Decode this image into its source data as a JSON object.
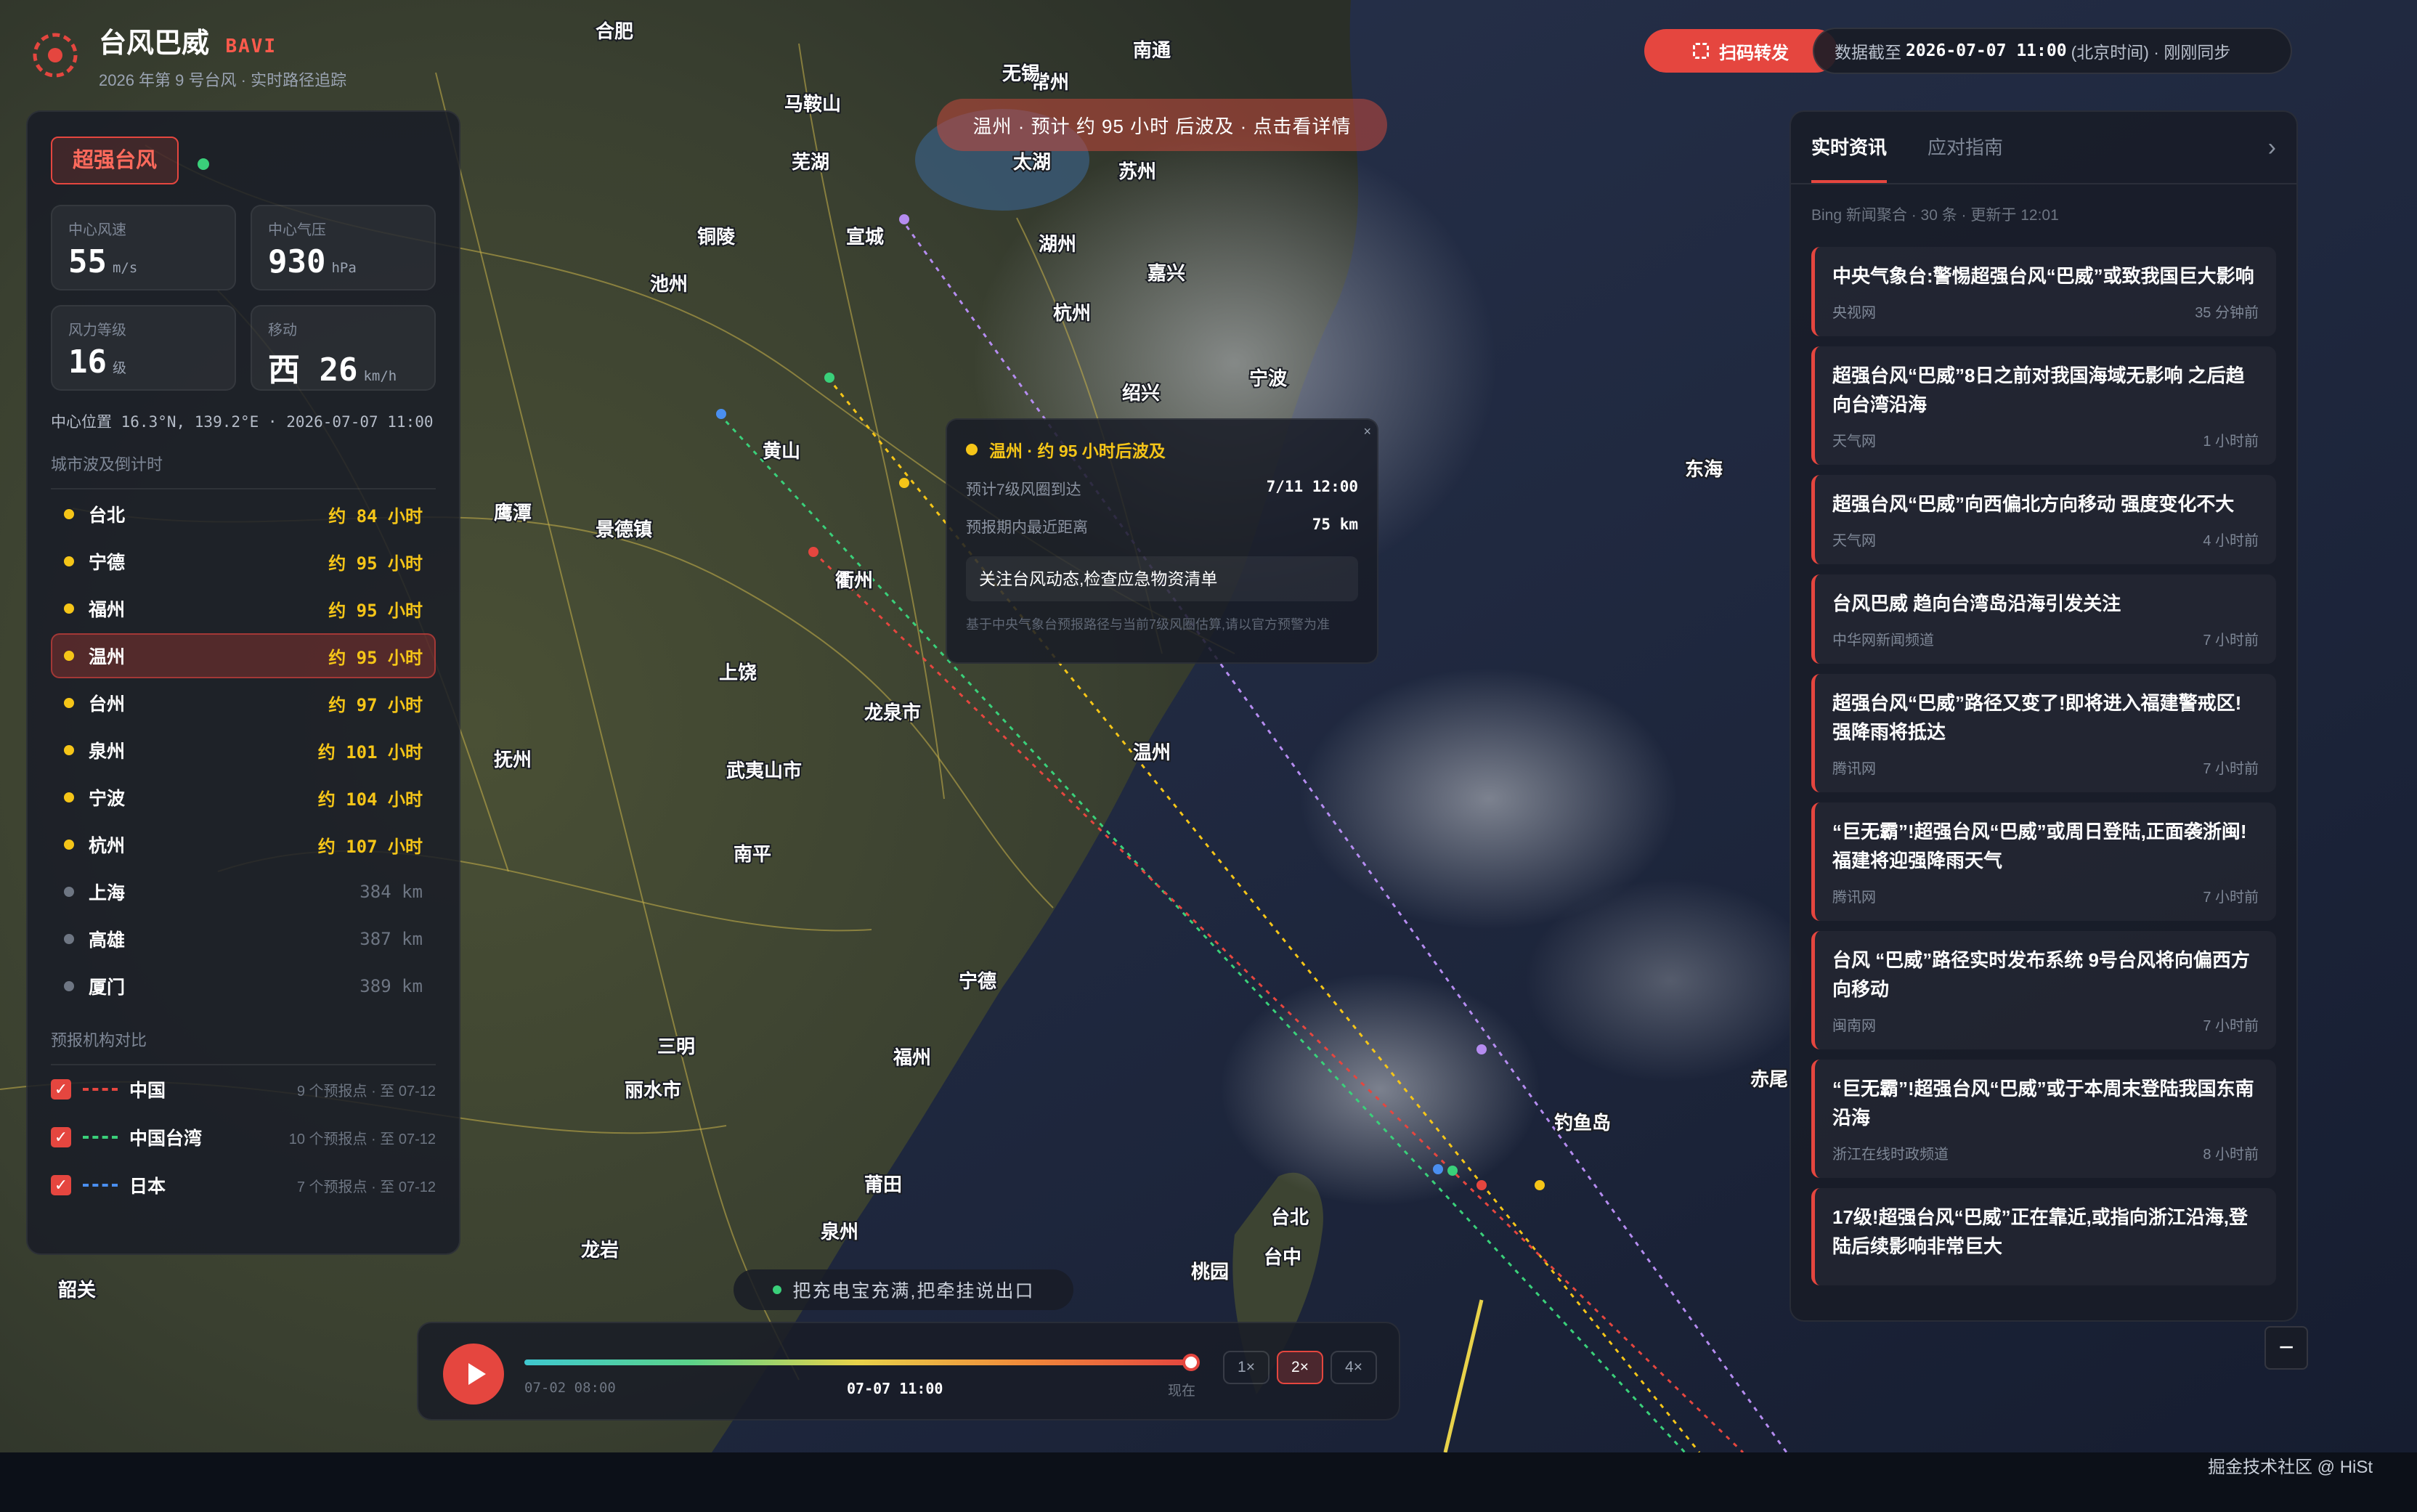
{
  "app": {
    "title": "台风巴威",
    "code": "BAVI",
    "subtitle": "2026 年第 9 号台风 · 实时路径追踪"
  },
  "header": {
    "share_label": "扫码转发",
    "data_time_prefix": "数据截至",
    "data_time_value": "2026-07-07 11:00",
    "data_time_suffix": "(北京时间) · 刚刚同步"
  },
  "alert_banner": "温州 · 预计 约 95 小时 后波及 · 点击看详情",
  "storm": {
    "level": "超强台风",
    "stats": [
      {
        "label": "中心风速",
        "value": "55",
        "unit": "m/s"
      },
      {
        "label": "中心气压",
        "value": "930",
        "unit": "hPa"
      },
      {
        "label": "风力等级",
        "value": "16",
        "unit": "级"
      },
      {
        "label": "移动",
        "value": "西 26",
        "unit": "km/h"
      }
    ],
    "center_position": "中心位置 16.3°N, 139.2°E · 2026-07-07 11:00"
  },
  "cities": {
    "title": "城市波及倒计时",
    "items": [
      {
        "name": "台北",
        "eta": "约 84 小时",
        "reached": true
      },
      {
        "name": "宁德",
        "eta": "约 95 小时",
        "reached": true
      },
      {
        "name": "福州",
        "eta": "约 95 小时",
        "reached": true
      },
      {
        "name": "温州",
        "eta": "约 95 小时",
        "reached": true
      },
      {
        "name": "台州",
        "eta": "约 97 小时",
        "reached": true
      },
      {
        "name": "泉州",
        "eta": "约 101 小时",
        "reached": true
      },
      {
        "name": "宁波",
        "eta": "约 104 小时",
        "reached": true
      },
      {
        "name": "杭州",
        "eta": "约 107 小时",
        "reached": true
      },
      {
        "name": "上海",
        "eta": "384 km",
        "reached": false
      },
      {
        "name": "高雄",
        "eta": "387 km",
        "reached": false
      },
      {
        "name": "厦门",
        "eta": "389 km",
        "reached": false
      }
    ]
  },
  "agencies": {
    "title": "预报机构对比",
    "items": [
      {
        "name": "中国",
        "meta": "9 个预报点 · 至 07-12",
        "color": "#e5463f"
      },
      {
        "name": "中国台湾",
        "meta": "10 个预报点 · 至 07-12",
        "color": "#3ad07a"
      },
      {
        "name": "日本",
        "meta": "7 个预报点 · 至 07-12",
        "color": "#4a8ff0"
      }
    ]
  },
  "popup": {
    "title": "温州 · 约 95 小时后波及",
    "rows": [
      {
        "label": "预计7级风圈到达",
        "value": "7/11 12:00"
      },
      {
        "label": "预报期内最近距离",
        "value": "75 km"
      }
    ],
    "advice": "关注台风动态,检查应急物资清单",
    "note": "基于中央气象台预报路径与当前7级风圈估算,请以官方预警为准",
    "close": "×"
  },
  "news": {
    "tabs": [
      "实时资讯",
      "应对指南"
    ],
    "meta": "Bing 新闻聚合 · 30 条 · 更新于 12:01",
    "items": [
      {
        "title": "中央气象台:警惕超强台风“巴威”或致我国巨大影响",
        "source": "央视网",
        "time": "35 分钟前"
      },
      {
        "title": "超强台风“巴威”8日之前对我国海域无影响 之后趋向台湾沿海",
        "source": "天气网",
        "time": "1 小时前"
      },
      {
        "title": "超强台风“巴威”向西偏北方向移动 强度变化不大",
        "source": "天气网",
        "time": "4 小时前"
      },
      {
        "title": "台风巴威 趋向台湾岛沿海引发关注",
        "source": "中华网新闻频道",
        "time": "7 小时前"
      },
      {
        "title": "超强台风“巴威”路径又变了!即将进入福建警戒区!强降雨将抵达",
        "source": "腾讯网",
        "time": "7 小时前"
      },
      {
        "title": "“巨无霸”!超强台风“巴威”或周日登陆,正面袭浙闽!福建将迎强降雨天气",
        "source": "腾讯网",
        "time": "7 小时前"
      },
      {
        "title": "台风 “巴威”路径实时发布系统 9号台风将向偏西方向移动",
        "source": "闽南网",
        "time": "7 小时前"
      },
      {
        "title": "“巨无霸”!超强台风“巴威”或于本周末登陆我国东南沿海",
        "source": "浙江在线时政频道",
        "time": "8 小时前"
      },
      {
        "title": "17级!超强台风“巴威”正在靠近,或指向浙江沿海,登陆后续影响非常巨大",
        "source": "",
        "time": ""
      }
    ]
  },
  "tip": "把充电宝充满,把牵挂说出口",
  "timeline": {
    "start": "07-02 08:00",
    "current": "07-07 11:00",
    "end_label": "现在",
    "progress": 1.0,
    "speeds": [
      "1×",
      "2×",
      "4×"
    ],
    "active_speed": "2×"
  },
  "map": {
    "places": [
      {
        "name": "合肥"
      },
      {
        "name": "南通"
      },
      {
        "name": "常州"
      },
      {
        "name": "马鞍山"
      },
      {
        "name": "芜湖"
      },
      {
        "name": "无锡"
      },
      {
        "name": "苏州"
      },
      {
        "name": "太湖"
      },
      {
        "name": "铜陵"
      },
      {
        "name": "宣城"
      },
      {
        "name": "湖州"
      },
      {
        "name": "嘉兴"
      },
      {
        "name": "杭州"
      },
      {
        "name": "绍兴"
      },
      {
        "name": "宁波"
      },
      {
        "name": "池州"
      },
      {
        "name": "黄山"
      },
      {
        "name": "景德镇"
      },
      {
        "name": "衢州"
      },
      {
        "name": "上饶"
      },
      {
        "name": "鹰潭"
      },
      {
        "name": "抚州"
      },
      {
        "name": "南平"
      },
      {
        "name": "温州"
      },
      {
        "name": "宁德"
      },
      {
        "name": "福州"
      },
      {
        "name": "三明"
      },
      {
        "name": "莆田"
      },
      {
        "name": "泉州"
      },
      {
        "name": "台北"
      },
      {
        "name": "台中"
      },
      {
        "name": "桃园"
      },
      {
        "name": "东海"
      },
      {
        "name": "钓鱼岛"
      },
      {
        "name": "赤尾"
      },
      {
        "name": "韶关"
      },
      {
        "name": "丽水市"
      },
      {
        "name": "龙泉市"
      },
      {
        "name": "武夷山市"
      },
      {
        "name": "龙岩"
      }
    ]
  },
  "credit": "掘金技术社区 @ HiSt",
  "colors": {
    "accent": "#e5463f",
    "warn": "#f5c518",
    "ok": "#3ad07a"
  }
}
